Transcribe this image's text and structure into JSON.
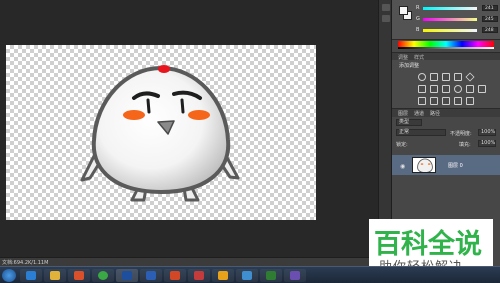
{
  "color_panel": {
    "sliders": [
      {
        "label": "R",
        "value": "241",
        "gradient": "linear-gradient(to right,#00f5f8,#f5f5f8)"
      },
      {
        "label": "G",
        "value": "245",
        "gradient": "linear-gradient(to right,#f100f8,#f1f5f8)"
      },
      {
        "label": "B",
        "value": "248",
        "gradient": "linear-gradient(to right,#f1f500,#f1f5ff)"
      }
    ]
  },
  "adjustments": {
    "tabs": [
      "调整",
      "样式"
    ],
    "title": "添加调整"
  },
  "layers": {
    "tabs": [
      "图层",
      "通道",
      "路径"
    ],
    "kind": "类型",
    "blend_mode": "正常",
    "opacity_label": "不透明度:",
    "opacity": "100%",
    "lock_label": "锁定:",
    "fill_label": "填充:",
    "fill": "100%",
    "layer_name": "图层 0"
  },
  "status": {
    "doc_info": "文档:694.2K/1.11M"
  },
  "watermark": {
    "main": "百科全说",
    "sub": "助你轻松解决"
  },
  "colors": {
    "accent_green": "#2fb34a",
    "selected_layer": "#596a83",
    "cheek_orange": "#f5651a",
    "top_red": "#e8141e"
  },
  "taskbar": {
    "apps": [
      "ie",
      "folder",
      "media",
      "browser",
      "photoshop",
      "word",
      "powerpoint",
      "app",
      "app2",
      "app3",
      "app4",
      "app5"
    ]
  }
}
